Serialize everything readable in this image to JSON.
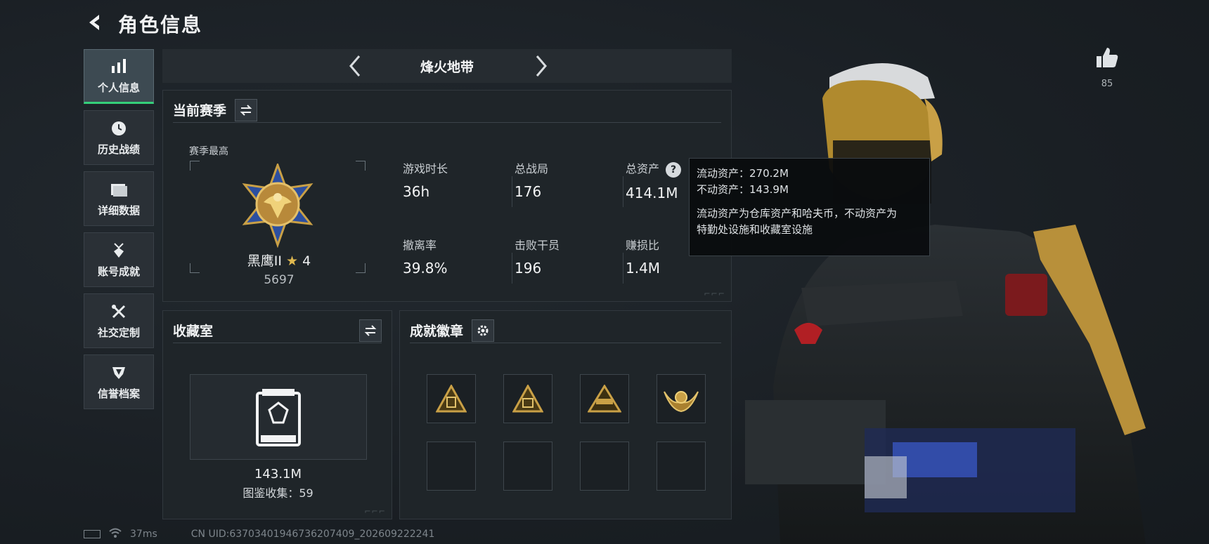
{
  "header": {
    "title": "角色信息"
  },
  "sidebar": {
    "items": [
      {
        "label": "个人信息",
        "icon": "bar-chart-icon",
        "active": true
      },
      {
        "label": "历史战绩",
        "icon": "clock-icon",
        "active": false
      },
      {
        "label": "详细数据",
        "icon": "folder-icon",
        "active": false
      },
      {
        "label": "账号成就",
        "icon": "medal-icon",
        "active": false
      },
      {
        "label": "社交定制",
        "icon": "tools-icon",
        "active": false
      },
      {
        "label": "信誉档案",
        "icon": "shield-icon",
        "active": false
      }
    ]
  },
  "season_bar": {
    "name": "烽火地带"
  },
  "current_season": {
    "title": "当前赛季",
    "season_best_label": "赛季最高",
    "rank_name": "黑鹰II",
    "rank_stars": "4",
    "rank_score": "5697",
    "stats": [
      {
        "label": "游戏时长",
        "value": "36h"
      },
      {
        "label": "总战局",
        "value": "176"
      },
      {
        "label": "总资产",
        "value": "414.1M"
      },
      {
        "label": "撤离率",
        "value": "39.8%"
      },
      {
        "label": "击败干员",
        "value": "196"
      },
      {
        "label": "赚损比",
        "value": "1.4M"
      }
    ]
  },
  "tooltip": {
    "line1": "流动资产：270.2M",
    "line2": "不动资产：143.9M",
    "line3": "流动资产为仓库资产和哈夫币，不动资产为",
    "line4": "特勤处设施和收藏室设施"
  },
  "collection": {
    "title": "收藏室",
    "value": "143.1M",
    "count_text": "图鉴收集：59"
  },
  "achievements": {
    "title": "成就徽章",
    "badges": [
      "badge-pyramid-icon",
      "badge-pyramid-icon",
      "badge-pyramid-icon",
      "badge-winged-icon",
      "",
      "",
      "",
      ""
    ]
  },
  "likes": {
    "count": "85"
  },
  "status_bar": {
    "ping": "37ms",
    "uid": "CN UID:63703401946736207409_202609222241"
  },
  "colors": {
    "accent_green": "#34d07a",
    "gold": "#c9a046"
  }
}
